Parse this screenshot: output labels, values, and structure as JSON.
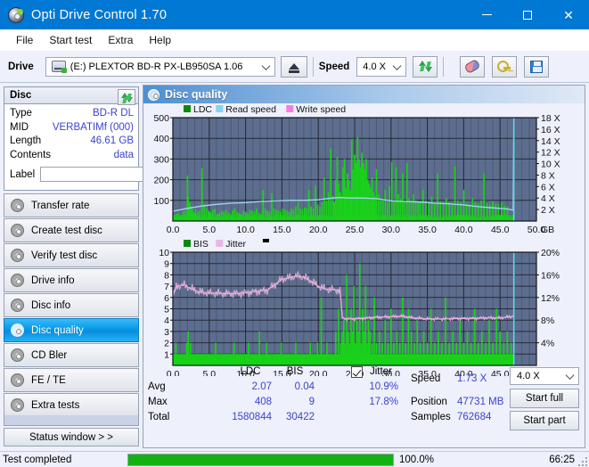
{
  "window": {
    "title": "Opti Drive Control 1.70",
    "icon": "disc-icon",
    "minimize": "minimize-icon",
    "maximize": "maximize-icon",
    "close": "close-icon"
  },
  "menu": {
    "items": [
      "File",
      "Start test",
      "Extra",
      "Help"
    ]
  },
  "toolbar": {
    "drive_label": "Drive",
    "drive_value": "(E:)   PLEXTOR BD-R  PX-LB950SA 1.06",
    "eject_title": "eject-icon",
    "refresh_title": "refresh-icon",
    "speed_label": "Speed",
    "speed_value": "4.0 X",
    "erase_title": "erase-icon",
    "keys_title": "keys-icon",
    "save_title": "save-icon"
  },
  "disc_panel": {
    "header": "Disc",
    "refresh_icon": "refresh-icon",
    "rows": [
      {
        "key": "Type",
        "value": "BD-R DL"
      },
      {
        "key": "MID",
        "value": "VERBATIMf (000)"
      },
      {
        "key": "Length",
        "value": "46.61 GB"
      },
      {
        "key": "Contents",
        "value": "data"
      }
    ],
    "label_key": "Label",
    "label_value": "",
    "label_button_icon": "cd-icon"
  },
  "sidebar": {
    "items": [
      {
        "label": "Transfer rate",
        "selected": false
      },
      {
        "label": "Create test disc",
        "selected": false
      },
      {
        "label": "Verify test disc",
        "selected": false
      },
      {
        "label": "Drive info",
        "selected": false
      },
      {
        "label": "Disc info",
        "selected": false
      },
      {
        "label": "Disc quality",
        "selected": true
      },
      {
        "label": "CD Bler",
        "selected": false
      },
      {
        "label": "FE / TE",
        "selected": false
      },
      {
        "label": "Extra tests",
        "selected": false
      }
    ],
    "status_window": "Status window > >"
  },
  "content": {
    "title": "Disc quality",
    "icon": "disc-icon"
  },
  "chart_data": [
    {
      "id": "ldc-chart",
      "type": "bar",
      "title": "",
      "xlabel": "GB",
      "ylabel": "",
      "xlim": [
        0,
        50
      ],
      "ylim": [
        0,
        500
      ],
      "xticks": [
        "0.0",
        "5.0",
        "10.0",
        "15.0",
        "20.0",
        "25.0",
        "30.0",
        "35.0",
        "40.0",
        "45.0",
        "50.0"
      ],
      "yticks": [
        "100",
        "200",
        "300",
        "400",
        "500"
      ],
      "y2ticks": [
        "2 X",
        "4 X",
        "6 X",
        "8 X",
        "10 X",
        "12 X",
        "14 X",
        "16 X",
        "18 X"
      ],
      "y2lim": [
        0,
        18
      ],
      "x_unit": "GB",
      "grid": true,
      "legend": [
        {
          "label": "LDC",
          "color": "#0a8a0a"
        },
        {
          "label": "Read speed",
          "color": "#86d2f0"
        },
        {
          "label": "Write speed",
          "color": "#f57fe0"
        }
      ],
      "scan_end_gb": 46.9,
      "series": [
        {
          "name": "LDC",
          "color": "#19d219",
          "kind": "bar",
          "x": [
            0.2,
            0.5,
            0.8,
            1.1,
            1.4,
            1.7,
            2.0,
            2.1,
            2.3,
            2.5,
            2.7,
            2.9,
            3.1,
            3.4,
            3.7,
            4.0,
            4.3,
            4.6,
            4.9,
            5.0,
            5.2,
            5.5,
            5.8,
            6.1,
            6.4,
            6.7,
            7.0,
            7.3,
            7.6,
            7.9,
            8.2,
            8.5,
            8.8,
            9.1,
            9.4,
            9.7,
            10.0,
            10.3,
            10.6,
            10.9,
            11.2,
            11.5,
            11.8,
            12.1,
            12.4,
            12.7,
            13.0,
            13.3,
            13.6,
            13.9,
            14.2,
            14.5,
            14.8,
            15.1,
            15.4,
            15.7,
            16.0,
            16.3,
            16.6,
            16.9,
            17.2,
            17.5,
            17.8,
            18.1,
            18.4,
            18.7,
            19.0,
            19.3,
            19.6,
            19.9,
            20.2,
            20.5,
            20.8,
            21.1,
            21.4,
            21.7,
            22.0,
            22.2,
            22.4,
            22.6,
            22.8,
            23.0,
            23.2,
            23.4,
            23.6,
            23.8,
            24.0,
            24.2,
            24.4,
            24.6,
            24.8,
            25.0,
            25.2,
            25.4,
            25.6,
            25.8,
            26.0,
            26.2,
            26.4,
            26.6,
            26.8,
            27.0,
            27.2,
            27.4,
            27.6,
            27.8,
            28.0,
            28.3,
            28.6,
            28.9,
            29.2,
            29.5,
            29.8,
            30.1,
            30.4,
            30.7,
            31.0,
            31.3,
            31.6,
            31.9,
            32.2,
            32.5,
            32.8,
            33.1,
            33.4,
            33.7,
            34.0,
            34.4,
            34.8,
            35.2,
            35.6,
            36.0,
            36.4,
            36.8,
            37.2,
            37.6,
            38.0,
            38.4,
            38.8,
            39.2,
            39.6,
            40.0,
            40.4,
            40.8,
            41.2,
            41.6,
            42.0,
            42.4,
            42.8,
            43.2,
            43.6,
            44.0,
            44.4,
            44.8,
            45.2,
            45.6,
            46.0,
            46.4,
            46.8
          ],
          "values": [
            30,
            35,
            40,
            28,
            45,
            50,
            220,
            120,
            90,
            70,
            55,
            40,
            60,
            45,
            50,
            255,
            80,
            60,
            50,
            45,
            40,
            55,
            60,
            35,
            40,
            50,
            45,
            55,
            40,
            35,
            50,
            60,
            45,
            40,
            35,
            50,
            45,
            40,
            55,
            50,
            45,
            60,
            40,
            35,
            150,
            60,
            50,
            45,
            135,
            60,
            55,
            50,
            45,
            60,
            55,
            50,
            45,
            60,
            55,
            70,
            90,
            60,
            55,
            65,
            60,
            150,
            70,
            60,
            170,
            80,
            70,
            90,
            210,
            100,
            140,
            350,
            120,
            90,
            200,
            310,
            180,
            140,
            120,
            260,
            300,
            160,
            230,
            200,
            150,
            395,
            250,
            320,
            280,
            405,
            300,
            260,
            330,
            280,
            250,
            300,
            200,
            180,
            160,
            210,
            140,
            120,
            250,
            130,
            110,
            100,
            150,
            90,
            170,
            285,
            100,
            260,
            130,
            110,
            230,
            95,
            280,
            110,
            100,
            130,
            100,
            95,
            90,
            150,
            100,
            90,
            120,
            85,
            230,
            95,
            85,
            110,
            90,
            80,
            265,
            100,
            90,
            150,
            85,
            80,
            110,
            90,
            85,
            100,
            230,
            85,
            80,
            95,
            85,
            80,
            90,
            75,
            70
          ]
        },
        {
          "name": "Read speed",
          "color": "#9fd9f2",
          "kind": "line",
          "x": [
            0.0,
            2.0,
            4.0,
            6.0,
            8.0,
            10.0,
            12.0,
            14.0,
            16.0,
            18.0,
            20.0,
            22.0,
            23.2,
            24.0,
            26.0,
            28.0,
            30.0,
            32.0,
            34.0,
            36.0,
            38.0,
            40.0,
            42.0,
            44.0,
            46.0,
            46.8,
            46.9
          ],
          "values_x_speed": [
            1.7,
            2.2,
            2.6,
            2.9,
            3.1,
            3.2,
            3.4,
            3.5,
            3.6,
            3.6,
            3.7,
            4.0,
            4.1,
            4.0,
            4.0,
            3.9,
            3.5,
            3.4,
            3.3,
            3.1,
            3.0,
            2.8,
            2.5,
            2.3,
            2.1,
            1.9,
            18.0
          ]
        }
      ]
    },
    {
      "id": "bis-chart",
      "type": "bar",
      "title": "",
      "xlabel": "GB",
      "xlim": [
        0,
        50
      ],
      "ylim": [
        0,
        10
      ],
      "xticks": [
        "0.0",
        "5.0",
        "10.0",
        "15.0",
        "20.0",
        "25.0",
        "30.0",
        "35.0",
        "40.0",
        "45.0",
        "50.0"
      ],
      "yticks": [
        "1",
        "2",
        "3",
        "4",
        "5",
        "6",
        "7",
        "8",
        "9",
        "10"
      ],
      "y2ticks": [
        "4%",
        "8%",
        "12%",
        "16%",
        "20%"
      ],
      "y2lim": [
        0,
        20
      ],
      "grid": true,
      "legend": [
        {
          "label": "BIS",
          "color": "#0a8a0a"
        },
        {
          "label": "Jitter",
          "color": "#e8b6e2"
        }
      ],
      "scan_end_gb": 46.9,
      "series": [
        {
          "name": "BIS",
          "color": "#19d219",
          "kind": "bar",
          "x": [
            0.4,
            0.9,
            1.4,
            1.9,
            2.1,
            2.4,
            2.9,
            3.4,
            3.9,
            4.4,
            4.9,
            5.4,
            5.9,
            6.4,
            6.9,
            7.4,
            7.9,
            8.4,
            8.9,
            9.4,
            9.9,
            10.4,
            10.9,
            11.4,
            11.9,
            12.4,
            12.9,
            13.4,
            13.9,
            14.4,
            14.9,
            15.4,
            15.9,
            16.4,
            16.9,
            17.4,
            17.9,
            18.4,
            18.9,
            19.4,
            19.9,
            20.4,
            20.9,
            21.2,
            21.6,
            22.0,
            22.4,
            22.8,
            23.1,
            23.3,
            23.5,
            23.7,
            23.9,
            24.1,
            24.3,
            24.5,
            24.7,
            24.9,
            25.1,
            25.3,
            25.5,
            25.7,
            25.9,
            26.1,
            26.3,
            26.5,
            26.7,
            26.9,
            27.1,
            27.4,
            27.7,
            28.0,
            28.4,
            28.8,
            29.2,
            29.6,
            30.0,
            30.4,
            30.8,
            31.2,
            31.6,
            32.0,
            32.4,
            32.8,
            33.2,
            33.6,
            34.0,
            34.5,
            35.0,
            35.5,
            36.0,
            36.5,
            37.0,
            37.5,
            38.0,
            38.5,
            39.0,
            39.5,
            40.0,
            40.5,
            41.0,
            41.5,
            42.0,
            42.5,
            43.0,
            43.5,
            44.0,
            44.5,
            45.0,
            45.5,
            46.0,
            46.5
          ],
          "values": [
            2,
            1,
            1,
            2,
            3,
            2,
            1,
            1,
            1,
            1,
            1,
            1,
            2,
            1,
            1,
            1,
            1,
            2,
            1,
            1,
            1,
            2,
            1,
            1,
            3,
            1,
            2,
            1,
            1,
            1,
            2,
            1,
            1,
            1,
            2,
            1,
            1,
            1,
            2,
            1,
            2,
            6,
            1,
            2,
            1,
            1,
            3,
            5,
            2,
            3,
            4,
            2,
            8,
            3,
            2,
            5,
            3,
            7,
            2,
            4,
            3,
            9,
            2,
            5,
            3,
            7,
            2,
            4,
            3,
            2,
            6,
            2,
            3,
            2,
            4,
            2,
            5,
            2,
            3,
            2,
            6,
            2,
            5,
            3,
            2,
            4,
            2,
            3,
            2,
            5,
            2,
            3,
            2,
            6,
            2,
            3,
            2,
            4,
            2,
            3,
            2,
            5,
            2,
            3,
            2,
            4,
            2,
            5,
            3,
            2,
            3,
            2
          ]
        },
        {
          "name": "Jitter",
          "color": "#e2afd9",
          "kind": "line",
          "x": [
            0.0,
            0.5,
            1.5,
            2.5,
            3.5,
            5.0,
            7.0,
            9.0,
            11.0,
            13.0,
            15.0,
            16.0,
            17.0,
            18.0,
            19.0,
            20.0,
            21.0,
            22.0,
            23.0,
            23.3,
            24.0,
            26.0,
            28.0,
            30.0,
            31.5,
            33.0,
            35.0,
            37.0,
            39.0,
            41.0,
            43.0,
            45.0,
            46.5,
            46.9
          ],
          "values_pct": [
            12.2,
            14.0,
            14.2,
            13.6,
            13.0,
            12.8,
            12.7,
            12.7,
            13.0,
            13.3,
            15.2,
            15.5,
            15.8,
            15.6,
            14.9,
            14.0,
            13.5,
            13.4,
            13.2,
            8.4,
            8.2,
            8.3,
            8.5,
            8.6,
            8.7,
            8.4,
            8.2,
            8.2,
            8.3,
            8.3,
            8.4,
            8.4,
            8.6,
            8.8
          ]
        }
      ]
    }
  ],
  "stats": {
    "col_headers": [
      "LDC",
      "BIS"
    ],
    "row_labels": [
      "Avg",
      "Max",
      "Total"
    ],
    "ldc": {
      "avg": "2.07",
      "max": "408",
      "total": "1580844"
    },
    "bis": {
      "avg": "0.04",
      "max": "9",
      "total": "30422"
    },
    "jitter_label": "Jitter",
    "jitter_checked": true,
    "jitter_avg": "10.9%",
    "jitter_max": "17.8%",
    "speed_label": "Speed",
    "speed_value": "1.73 X",
    "position_label": "Position",
    "position_value": "47731 MB",
    "samples_label": "Samples",
    "samples_value": "762684",
    "speed_select": "4.0 X",
    "start_full": "Start full",
    "start_part": "Start part"
  },
  "statusbar": {
    "message": "Test completed",
    "progress_percent": 100,
    "progress_text": "100.0%",
    "elapsed": "66:25"
  },
  "colors": {
    "title_blue": "#0078d4",
    "accent_value": "#3a43d0",
    "plot_bg": "#5d6d8e",
    "green": "#19d219",
    "progress_green": "#12b212"
  }
}
